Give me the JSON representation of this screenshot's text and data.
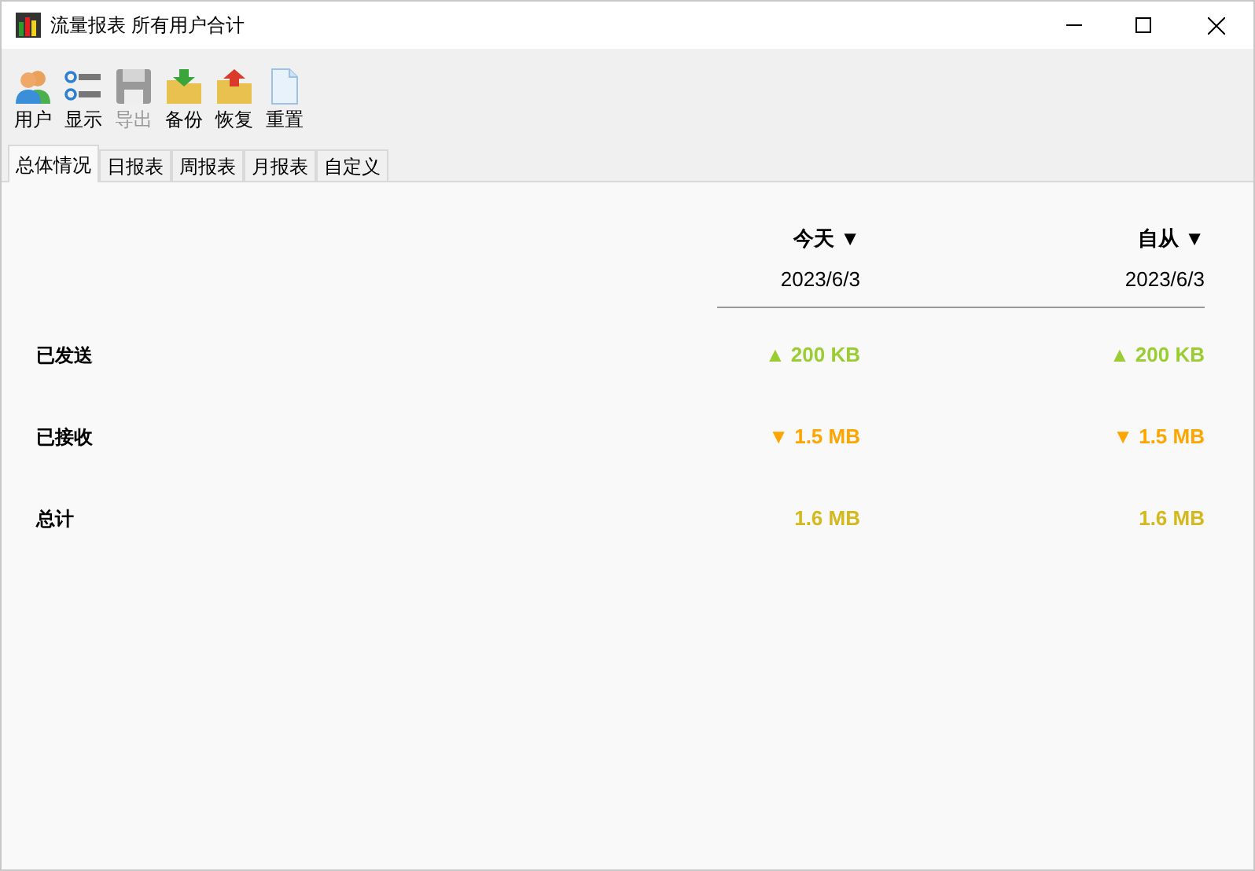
{
  "window": {
    "title": "流量报表 所有用户合计"
  },
  "toolbar": [
    {
      "kind": "users",
      "label": "用户",
      "disabled": false
    },
    {
      "kind": "list",
      "label": "显示",
      "disabled": false
    },
    {
      "kind": "save",
      "label": "导出",
      "disabled": true
    },
    {
      "kind": "backup",
      "label": "备份",
      "disabled": false
    },
    {
      "kind": "restore",
      "label": "恢复",
      "disabled": false
    },
    {
      "kind": "reset",
      "label": "重置",
      "disabled": false
    }
  ],
  "tabs": [
    {
      "label": "总体情况",
      "selected": true
    },
    {
      "label": "日报表",
      "selected": false
    },
    {
      "label": "周报表",
      "selected": false
    },
    {
      "label": "月报表",
      "selected": false
    },
    {
      "label": "自定义",
      "selected": false
    }
  ],
  "columns": [
    {
      "heading": "今天 ▼",
      "date": "2023/6/3"
    },
    {
      "heading": "自从 ▼",
      "date": "2023/6/3"
    }
  ],
  "rows": [
    {
      "label": "已发送",
      "color": "#9acd32",
      "values": [
        "▲ 200 KB",
        "▲ 200 KB"
      ]
    },
    {
      "label": "已接收",
      "color": "#ffa500",
      "values": [
        "▼ 1.5 MB",
        "▼ 1.5 MB"
      ]
    },
    {
      "label": "总计",
      "color": "#d4b81c",
      "values": [
        "1.6 MB",
        "1.6 MB"
      ]
    }
  ]
}
